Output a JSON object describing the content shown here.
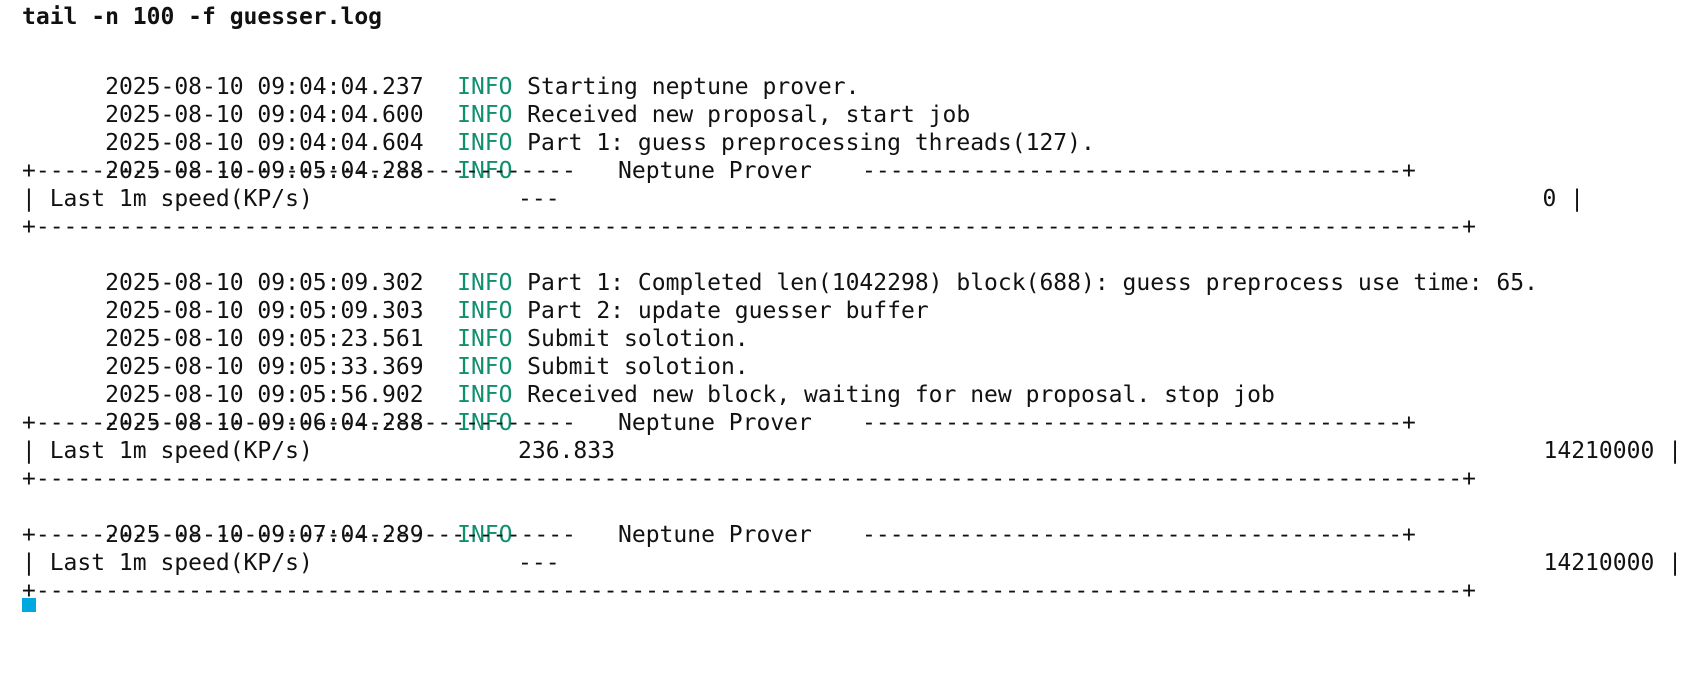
{
  "command": "tail -n 100 -f guesser.log",
  "colors": {
    "info_level": "#0f8f6e",
    "cursor": "#00a8e0"
  },
  "logs": [
    {
      "ts": "2025-08-10 09:04:04.237",
      "level": "INFO",
      "msg": "Starting neptune prover."
    },
    {
      "ts": "2025-08-10 09:04:04.600",
      "level": "INFO",
      "msg": "Received new proposal, start job"
    },
    {
      "ts": "2025-08-10 09:04:04.604",
      "level": "INFO",
      "msg": "Part 1: guess preprocessing threads(127)."
    },
    {
      "ts": "2025-08-10 09:05:04.288",
      "level": "INFO",
      "msg": ""
    },
    {
      "ts": "2025-08-10 09:05:09.302",
      "level": "INFO",
      "msg": "Part 1: Completed len(1042298) block(688): guess preprocess use time: 65."
    },
    {
      "ts": "2025-08-10 09:05:09.303",
      "level": "INFO",
      "msg": "Part 2: update guesser buffer"
    },
    {
      "ts": "2025-08-10 09:05:23.561",
      "level": "INFO",
      "msg": "Submit solotion."
    },
    {
      "ts": "2025-08-10 09:05:33.369",
      "level": "INFO",
      "msg": "Submit solotion."
    },
    {
      "ts": "2025-08-10 09:05:56.902",
      "level": "INFO",
      "msg": "Received new block, waiting for new proposal. stop job"
    },
    {
      "ts": "2025-08-10 09:06:04.288",
      "level": "INFO",
      "msg": ""
    },
    {
      "ts": "2025-08-10 09:07:04.289",
      "level": "INFO",
      "msg": ""
    }
  ],
  "table_border": {
    "left": "+---------------------------------------",
    "title": "Neptune Prover",
    "right": "---------------------------------------+",
    "bottom": "+-------------------------------------------------------------------------------------------------------+"
  },
  "stats": [
    {
      "label": "| Last 1m speed(KP/s)",
      "speed": "---",
      "total": "0 |"
    },
    {
      "label": "| Last 1m speed(KP/s)",
      "speed": "236.833",
      "total": "14210000 |"
    },
    {
      "label": "| Last 1m speed(KP/s)",
      "speed": "---",
      "total": "14210000 |"
    }
  ]
}
